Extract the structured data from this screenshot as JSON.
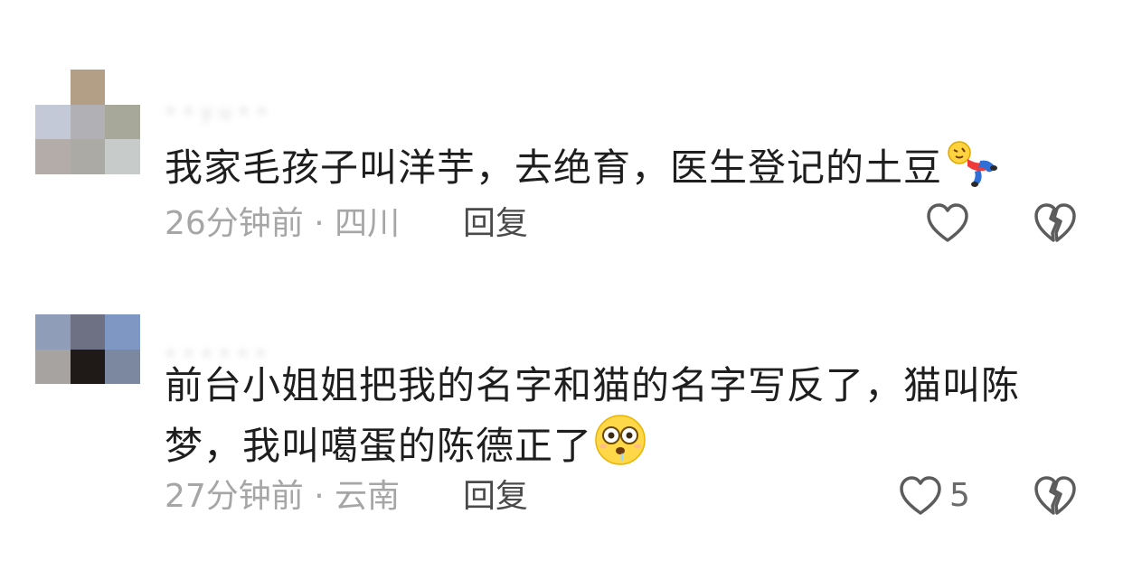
{
  "comments": [
    {
      "username": "• • y u • •",
      "avatar_colors": [
        "#ffffff",
        "#b39e86",
        "#ffffff",
        "#c3c9d6",
        "#b1b1b5",
        "#a7a89a",
        "#b4aca8",
        "#abaaa4",
        "#c7cbca"
      ],
      "text": "我家毛孩子叫洋芋，去绝育，医生登记的土豆",
      "emoji_icon": "fallen-person-emoji-icon",
      "time": "26分钟前",
      "location": "四川",
      "separator": " · ",
      "reply_label": "回复",
      "like_count": ""
    },
    {
      "username": "• • • • • •",
      "avatar_colors": [
        "#8f9db8",
        "#6e7183",
        "#7e98c3",
        "#a7a3a0",
        "#1f1a17",
        "#7c87a0",
        "#ffffff",
        "#ffffff",
        "#ffffff"
      ],
      "text": "前台小姐姐把我的名字和猫的名字写反了，猫叫陈梦，我叫噶蛋的陈德正了",
      "emoji_icon": "drooling-shocked-face-emoji-icon",
      "time": "27分钟前",
      "location": "云南",
      "separator": " · ",
      "reply_label": "回复",
      "like_count": "5"
    }
  ]
}
